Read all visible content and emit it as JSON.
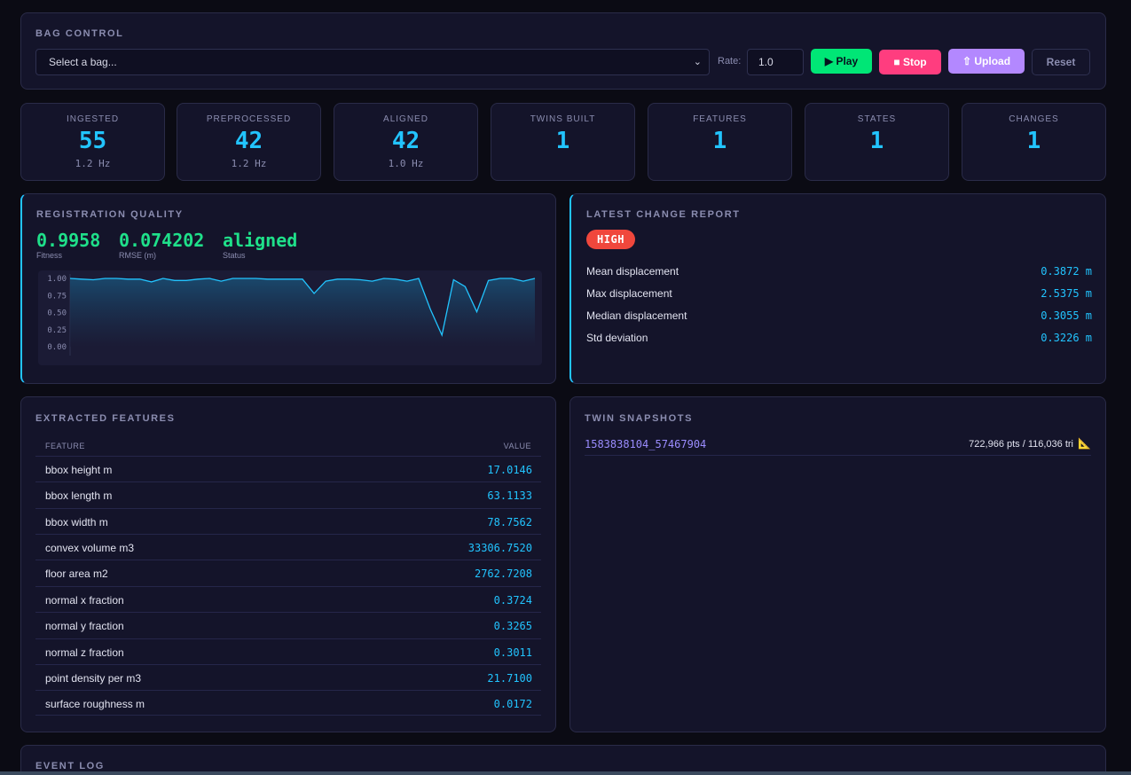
{
  "bag_control": {
    "title": "BAG CONTROL",
    "select_placeholder": "Select a bag...",
    "rate_label": "Rate:",
    "rate_value": "1.0",
    "play_label": "▶ Play",
    "stop_label": "■ Stop",
    "upload_label": "⇧ Upload",
    "reset_label": "Reset"
  },
  "stats": [
    {
      "label": "INGESTED",
      "value": "55",
      "rate": "1.2 Hz"
    },
    {
      "label": "PREPROCESSED",
      "value": "42",
      "rate": "1.2 Hz"
    },
    {
      "label": "ALIGNED",
      "value": "42",
      "rate": "1.0 Hz"
    },
    {
      "label": "TWINS BUILT",
      "value": "1",
      "rate": ""
    },
    {
      "label": "FEATURES",
      "value": "1",
      "rate": ""
    },
    {
      "label": "STATES",
      "value": "1",
      "rate": ""
    },
    {
      "label": "CHANGES",
      "value": "1",
      "rate": ""
    }
  ],
  "registration": {
    "title": "REGISTRATION QUALITY",
    "fitness_value": "0.9958",
    "fitness_label": "Fitness",
    "rmse_value": "0.074202",
    "rmse_label": "RMSE (m)",
    "status_value": "aligned",
    "status_label": "Status"
  },
  "chart_data": {
    "type": "area",
    "title": "",
    "xlabel": "",
    "ylabel": "",
    "ylim": [
      0,
      1
    ],
    "y_ticks": [
      "1.00",
      "0.75",
      "0.50",
      "0.25",
      "0.00"
    ],
    "grid": false,
    "series": [
      {
        "values": [
          1.0,
          0.99,
          0.98,
          1.0,
          1.0,
          0.99,
          0.99,
          0.95,
          1.0,
          0.97,
          0.97,
          0.99,
          1.0,
          0.96,
          1.0,
          1.0,
          1.0,
          0.99,
          0.99,
          0.99,
          0.99,
          0.78,
          0.96,
          0.99,
          0.99,
          0.98,
          0.96,
          1.0,
          0.99,
          0.96,
          1.0,
          0.55,
          0.17,
          0.98,
          0.88,
          0.51,
          0.97,
          1.0,
          1.0,
          0.96,
          1.0
        ]
      }
    ],
    "line_color": "#22c4ff"
  },
  "change_report": {
    "title": "LATEST CHANGE REPORT",
    "severity": "HIGH",
    "rows": [
      {
        "label": "Mean displacement",
        "value": "0.3872 m"
      },
      {
        "label": "Max displacement",
        "value": "2.5375 m"
      },
      {
        "label": "Median displacement",
        "value": "0.3055 m"
      },
      {
        "label": "Std deviation",
        "value": "0.3226 m"
      }
    ]
  },
  "features": {
    "title": "EXTRACTED FEATURES",
    "col_feature": "FEATURE",
    "col_value": "VALUE",
    "rows": [
      {
        "name": "bbox height m",
        "value": "17.0146"
      },
      {
        "name": "bbox length m",
        "value": "63.1133"
      },
      {
        "name": "bbox width m",
        "value": "78.7562"
      },
      {
        "name": "convex volume m3",
        "value": "33306.7520"
      },
      {
        "name": "floor area m2",
        "value": "2762.7208"
      },
      {
        "name": "normal x fraction",
        "value": "0.3724"
      },
      {
        "name": "normal y fraction",
        "value": "0.3265"
      },
      {
        "name": "normal z fraction",
        "value": "0.3011"
      },
      {
        "name": "point density per m3",
        "value": "21.7100"
      },
      {
        "name": "surface roughness m",
        "value": "0.0172"
      }
    ]
  },
  "snapshots": {
    "title": "TWIN SNAPSHOTS",
    "items": [
      {
        "id": "1583838104_57467904",
        "stats": "722,966 pts / 116,036 tri",
        "icon": "triangle-ruler-icon"
      }
    ]
  },
  "event_log": {
    "title": "EVENT LOG"
  },
  "colors": {
    "accent": "#22c4ff",
    "success": "#1fe08a",
    "danger": "#f0473c",
    "play": "#00e676",
    "stop": "#ff3d7f",
    "upload": "#b388ff"
  }
}
